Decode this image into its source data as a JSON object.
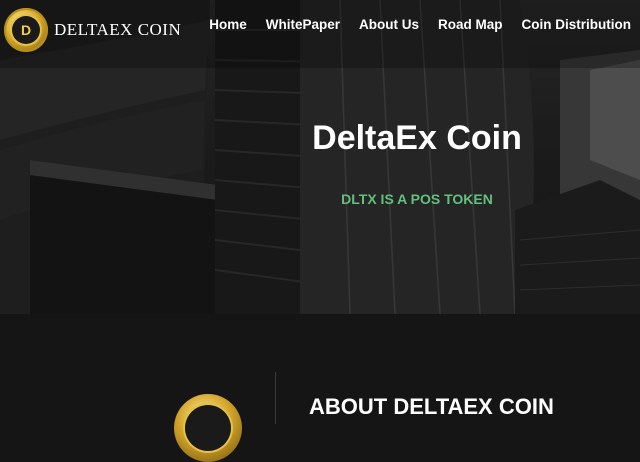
{
  "brand": {
    "name": "DELTAEX COIN",
    "coin_glyph": "D"
  },
  "nav": {
    "items": [
      {
        "label": "Home"
      },
      {
        "label": "WhitePaper"
      },
      {
        "label": "About Us"
      },
      {
        "label": "Road Map"
      },
      {
        "label": "Coin Distribution"
      }
    ]
  },
  "hero": {
    "title": "DeltaEx Coin",
    "subtitle": "DLTX IS A POS TOKEN"
  },
  "about": {
    "title": "ABOUT DELTAEX COIN"
  },
  "colors": {
    "accent_green": "#62c07e",
    "coin_gold": "#d9a928",
    "background": "#151515"
  }
}
